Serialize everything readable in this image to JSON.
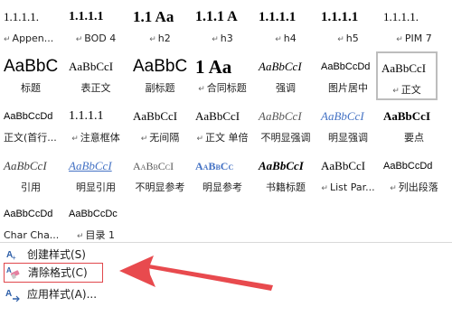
{
  "rows": [
    [
      {
        "preview": "1.1.1.1.",
        "label": "Appen...",
        "marker": "↵",
        "bold": false
      },
      {
        "preview": "1.1.1.1",
        "label": "BOD 4",
        "marker": "↵",
        "bold": true
      },
      {
        "preview": "1.1 Aa",
        "label": "h2",
        "marker": "↵",
        "bold": true
      },
      {
        "preview": "1.1.1 A",
        "label": "h3",
        "marker": "↵",
        "bold": true
      },
      {
        "preview": "1.1.1.1",
        "label": "h4",
        "marker": "↵",
        "bold": true
      },
      {
        "preview": "1.1.1.1",
        "label": "h5",
        "marker": "↵",
        "bold": true
      },
      {
        "preview": "1.1.1.1.",
        "label": "PIM 7",
        "marker": "↵",
        "bold": false
      }
    ],
    [
      {
        "preview": "AaBbC",
        "label": "标题",
        "marker": "",
        "bold": false
      },
      {
        "preview": "AaBbCcI",
        "label": "表正文",
        "marker": "",
        "bold": false
      },
      {
        "preview": "AaBbC",
        "label": "副标题",
        "marker": "",
        "bold": false
      },
      {
        "preview": "1 Aa",
        "label": "合同标题",
        "marker": "↵",
        "bold": true
      },
      {
        "preview": "AaBbCcI",
        "label": "强调",
        "marker": "",
        "bold": false
      },
      {
        "preview": "AaBbCcDd",
        "label": "图片居中",
        "marker": "",
        "bold": false
      },
      {
        "preview": "AaBbCcI",
        "label": "正文",
        "marker": "↵",
        "bold": false
      }
    ],
    [
      {
        "preview": "AaBbCcDd",
        "label": "正文(首行...",
        "marker": "",
        "bold": false
      },
      {
        "preview": "1.1.1.1",
        "label": "注意框体",
        "marker": "↵",
        "bold": false
      },
      {
        "preview": "AaBbCcI",
        "label": "无间隔",
        "marker": "↵",
        "bold": false
      },
      {
        "preview": "AaBbCcI",
        "label": "正文 单倍",
        "marker": "↵",
        "bold": false
      },
      {
        "preview": "AaBbCcI",
        "label": "不明显强调",
        "marker": "",
        "bold": false
      },
      {
        "preview": "AaBbCcI",
        "label": "明显强调",
        "marker": "",
        "bold": false
      },
      {
        "preview": "AaBbCcI",
        "label": "要点",
        "marker": "",
        "bold": true
      }
    ],
    [
      {
        "preview": "AaBbCcI",
        "label": "引用",
        "marker": "",
        "bold": false
      },
      {
        "preview": "AaBbCcI",
        "label": "明显引用",
        "marker": "",
        "bold": false
      },
      {
        "preview": "AaBbCcI",
        "label": "不明显参考",
        "marker": "",
        "bold": false
      },
      {
        "preview": "AaBbCc",
        "label": "明显参考",
        "marker": "",
        "bold": true
      },
      {
        "preview": "AaBbCcI",
        "label": "书籍标题",
        "marker": "",
        "bold": true
      },
      {
        "preview": "AaBbCcI",
        "label": "List Par...",
        "marker": "↵",
        "bold": false
      },
      {
        "preview": "AaBbCcDd",
        "label": "列出段落",
        "marker": "↵",
        "bold": false
      }
    ],
    [
      {
        "preview": "AaBbCcDd",
        "label": "Char Cha...",
        "marker": "",
        "bold": false
      },
      {
        "preview": "AaBbCcDc",
        "label": "目录 1",
        "marker": "↵",
        "bold": false
      }
    ]
  ],
  "menu": {
    "create_style": "创建样式(S)",
    "clear_format": "清除格式(C)",
    "apply_style": "应用样式(A)..."
  },
  "colors": {
    "highlight": "#e0474c",
    "arrow": "#e0474c",
    "blue": "#4472c4",
    "gray": "#7f7f7f"
  },
  "icons": [
    "create-style-icon",
    "clear-format-icon",
    "apply-style-icon"
  ]
}
